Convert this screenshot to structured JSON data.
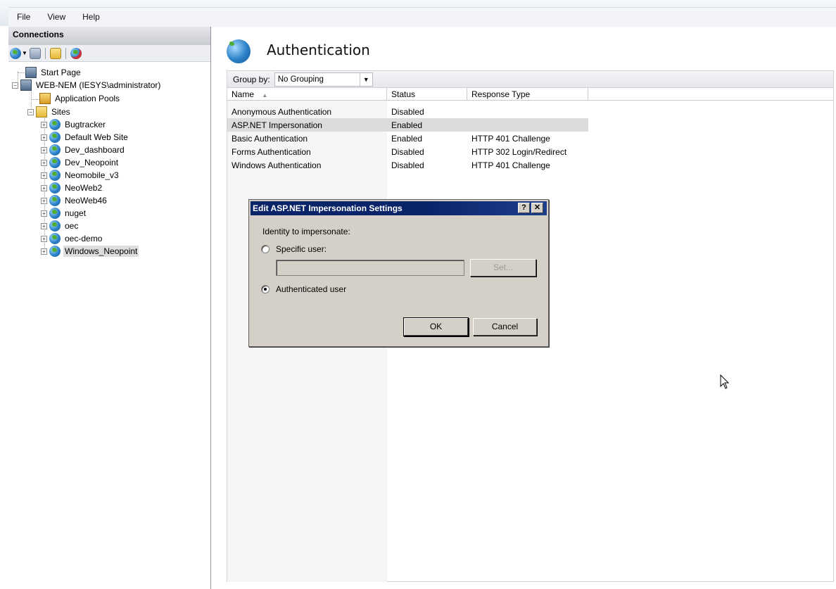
{
  "menu": [
    "File",
    "View",
    "Help"
  ],
  "connections": {
    "title": "Connections",
    "toolbar_icons": [
      "connect-icon",
      "dropdown-arrow-icon",
      "save-icon",
      "up-folder-icon",
      "disconnect-icon"
    ],
    "tree": {
      "start_page": "Start Page",
      "server": "WEB-NEM (IESYS\\administrator)",
      "app_pools": "Application Pools",
      "sites": "Sites",
      "site_items": [
        "Bugtracker",
        "Default Web Site",
        "Dev_dashboard",
        "Dev_Neopoint",
        "Neomobile_v3",
        "NeoWeb2",
        "NeoWeb46",
        "nuget",
        "oec",
        "oec-demo",
        "Windows_Neopoint"
      ],
      "selected": "Windows_Neopoint"
    }
  },
  "main": {
    "title": "Authentication",
    "group_by_label": "Group by:",
    "group_by_value": "No Grouping",
    "columns": [
      "Name",
      "Status",
      "Response Type"
    ],
    "sort_indicator": "▲",
    "rows": [
      {
        "name": "Anonymous Authentication",
        "status": "Disabled",
        "response": ""
      },
      {
        "name": "ASP.NET Impersonation",
        "status": "Enabled",
        "response": ""
      },
      {
        "name": "Basic Authentication",
        "status": "Enabled",
        "response": "HTTP 401 Challenge"
      },
      {
        "name": "Forms Authentication",
        "status": "Disabled",
        "response": "HTTP 302 Login/Redirect"
      },
      {
        "name": "Windows Authentication",
        "status": "Disabled",
        "response": "HTTP 401 Challenge"
      }
    ],
    "selected_row": 1
  },
  "dialog": {
    "title": "Edit ASP.NET Impersonation Settings",
    "help_label": "?",
    "close_label": "✕",
    "identity_label": "Identity to impersonate:",
    "specific_user_label": "Specific user:",
    "specific_user_value": "",
    "set_label": "Set...",
    "authenticated_user_label": "Authenticated user",
    "selected_option": "authenticated",
    "ok_label": "OK",
    "cancel_label": "Cancel"
  },
  "colors": {
    "dialog_title_bg": "#0a246a",
    "dialog_bg": "#d4d0c8",
    "selection": "#dcdcdc"
  }
}
